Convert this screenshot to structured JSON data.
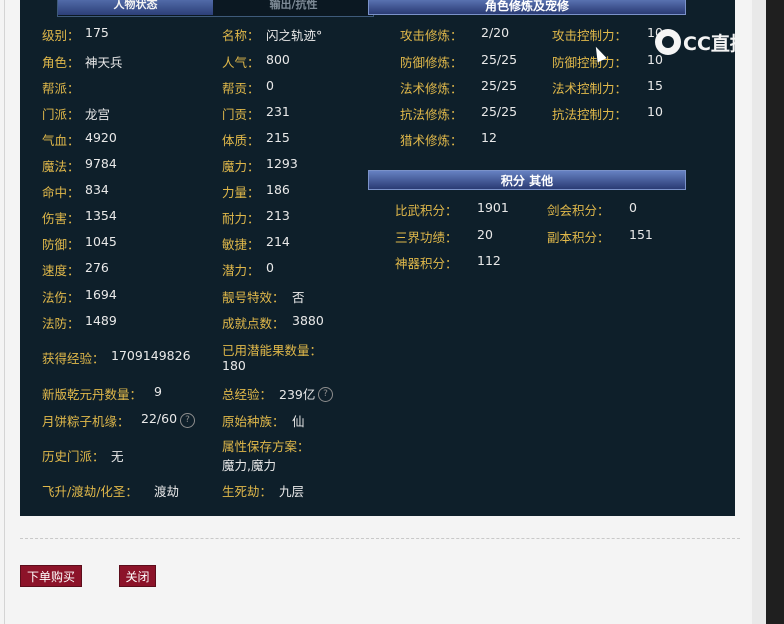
{
  "tabs": [
    "人物状态",
    "输出/抗性"
  ],
  "left_stats": [
    {
      "label": "级别：",
      "value": "175"
    },
    {
      "label": "名称：",
      "value": "闪之轨迹°"
    },
    {
      "label": "角色：",
      "value": "神天兵"
    },
    {
      "label": "人气：",
      "value": "800"
    },
    {
      "label": "帮派：",
      "value": ""
    },
    {
      "label": "帮贡：",
      "value": "0"
    },
    {
      "label": "门派：",
      "value": "龙宫"
    },
    {
      "label": "门贡：",
      "value": "231"
    },
    {
      "label": "气血：",
      "value": "4920"
    },
    {
      "label": "体质：",
      "value": "215"
    },
    {
      "label": "魔法：",
      "value": "9784"
    },
    {
      "label": "魔力：",
      "value": "1293"
    },
    {
      "label": "命中：",
      "value": "834"
    },
    {
      "label": "力量：",
      "value": "186"
    },
    {
      "label": "伤害：",
      "value": "1354"
    },
    {
      "label": "耐力：",
      "value": "213"
    },
    {
      "label": "防御：",
      "value": "1045"
    },
    {
      "label": "敏捷：",
      "value": "214"
    },
    {
      "label": "速度：",
      "value": "276"
    },
    {
      "label": "潜力：",
      "value": "0"
    },
    {
      "label": "法伤：",
      "value": "1694"
    },
    {
      "label": "靓号特效：",
      "value": "否"
    },
    {
      "label": "法防：",
      "value": "1489"
    },
    {
      "label": "成就点数：",
      "value": "3880"
    },
    {
      "label": "获得经验：",
      "value": "1709149826"
    },
    {
      "label": "已用潜能果数量：",
      "value": "180"
    },
    {
      "label": "新版乾元丹数量：",
      "value": "9"
    },
    {
      "label": "总经验：",
      "value": "239亿"
    },
    {
      "label": "月饼粽子机缘：",
      "value": "22/60"
    },
    {
      "label": "原始种族：",
      "value": "仙"
    },
    {
      "label": "历史门派：",
      "value": "无"
    },
    {
      "label": "属性保存方案：",
      "value": "魔力,魔力"
    },
    {
      "label": "飞升/渡劫/化圣：",
      "value": "渡劫"
    },
    {
      "label": "生死劫：",
      "value": "九层"
    }
  ],
  "cultivation": {
    "title": "角色修炼及宠修",
    "items": [
      {
        "label": "攻击修炼：",
        "value": "2/20"
      },
      {
        "label": "攻击控制力：",
        "value": "10"
      },
      {
        "label": "防御修炼：",
        "value": "25/25"
      },
      {
        "label": "防御控制力：",
        "value": "10"
      },
      {
        "label": "法术修炼：",
        "value": "25/25"
      },
      {
        "label": "法术控制力：",
        "value": "15"
      },
      {
        "label": "抗法修炼：",
        "value": "25/25"
      },
      {
        "label": "抗法控制力：",
        "value": "10"
      },
      {
        "label": "猎术修炼：",
        "value": "12"
      }
    ]
  },
  "scores": {
    "title": "积分 其他",
    "items": [
      {
        "label": "比武积分：",
        "value": "1901"
      },
      {
        "label": "剑会积分：",
        "value": "0"
      },
      {
        "label": "三界功绩：",
        "value": "20"
      },
      {
        "label": "副本积分：",
        "value": "151"
      },
      {
        "label": "神器积分：",
        "value": "112"
      }
    ]
  },
  "help_icon": "?",
  "watermark": {
    "icon": "cc-logo-icon",
    "text": "CC直播"
  },
  "buttons": {
    "buy": "下单购买",
    "close": "关闭"
  },
  "colors": {
    "label": "#e0b84a",
    "value": "#e9e9e9",
    "panel": "#0e1f2a",
    "button": "#8c1329"
  }
}
